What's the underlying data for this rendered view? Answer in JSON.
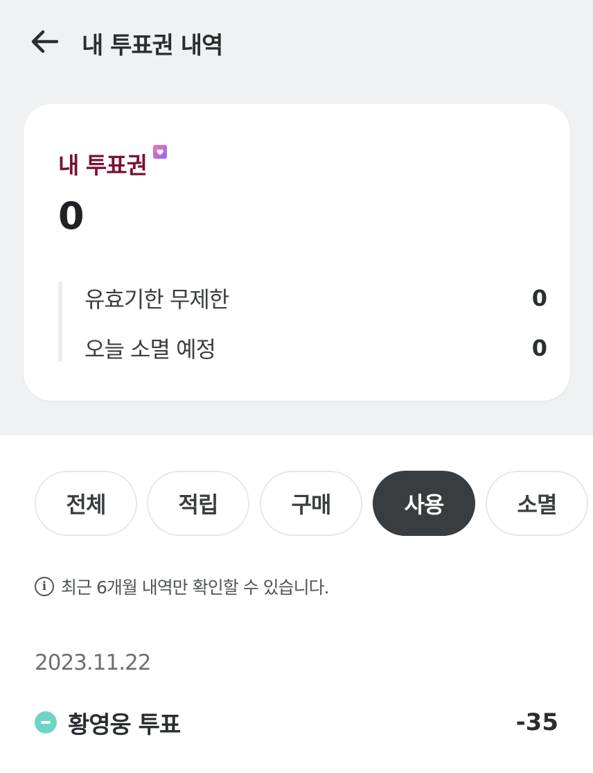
{
  "header": {
    "title": "내 투표권 내역",
    "back_icon": "arrow-left-icon"
  },
  "card": {
    "title": "내 투표권",
    "ticket_icon": "heart-ticket-icon",
    "total": "0",
    "details": [
      {
        "label": "유효기한 무제한",
        "value": "0"
      },
      {
        "label": "오늘 소멸 예정",
        "value": "0"
      }
    ]
  },
  "tabs": [
    {
      "label": "전체",
      "active": false
    },
    {
      "label": "적립",
      "active": false
    },
    {
      "label": "구매",
      "active": false
    },
    {
      "label": "사용",
      "active": true
    },
    {
      "label": "소멸",
      "active": false
    }
  ],
  "notice": {
    "icon": "info-icon",
    "text": "최근 6개월 내역만 확인할 수 있습니다."
  },
  "history": {
    "date": "2023.11.22",
    "items": [
      {
        "name": "황영웅 투표",
        "amount": "-35",
        "icon": "minus-circle-icon"
      }
    ]
  },
  "colors": {
    "top_background": "#f0f1f3",
    "card_title": "#7a1231",
    "active_tab": "#3a3d40",
    "minus_icon": "#6fd3c5"
  }
}
